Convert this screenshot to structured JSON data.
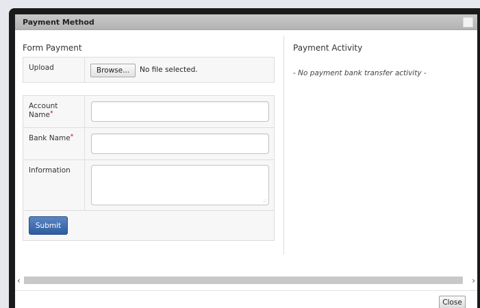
{
  "dialog": {
    "title": "Payment Method"
  },
  "form": {
    "heading": "Form Payment",
    "upload_label": "Upload",
    "browse_label": "Browse...",
    "file_status": "No file selected.",
    "account_name_label": "Account Name",
    "account_name_value": "",
    "bank_name_label": "Bank Name",
    "bank_name_value": "",
    "information_label": "Information",
    "information_value": "",
    "required_mark": "*",
    "submit_label": "Submit"
  },
  "activity": {
    "heading": "Payment Activity",
    "empty_message": "- No payment bank transfer activity -"
  },
  "scrollbar": {
    "left_arrow": "‹",
    "right_arrow": "›"
  },
  "footer": {
    "close_label": "Close"
  },
  "colors": {
    "submit": "#2d5c9e",
    "required": "#cc0000",
    "titlebar": "#bdbdbd"
  }
}
